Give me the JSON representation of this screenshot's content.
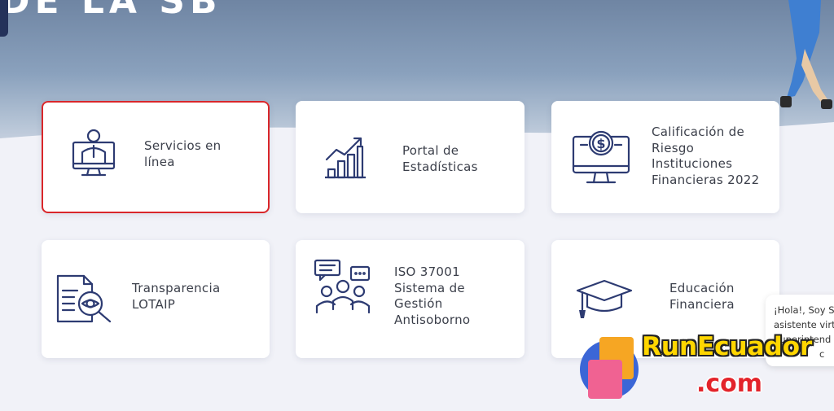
{
  "hero": {
    "title": "DE LA SB"
  },
  "cards": [
    {
      "label": "Servicios en línea",
      "icon": "online-services-icon",
      "selected": true
    },
    {
      "label": "Portal de Estadísticas",
      "icon": "statistics-chart-icon"
    },
    {
      "label": "Calificación de Riesgo Instituciones Financieras 2022",
      "icon": "dollar-monitor-icon"
    },
    {
      "label": "Transparencia LOTAIP",
      "icon": "document-search-icon"
    },
    {
      "label": "ISO 37001 Sistema de Gestión Antisoborno",
      "icon": "team-chat-icon"
    },
    {
      "label": "Educación Financiera",
      "icon": "graduation-cap-icon"
    }
  ],
  "chat": {
    "line1": "¡Hola!, Soy S",
    "line2": "asistente virt",
    "line3": "Superintend",
    "line4": "c"
  },
  "watermark": {
    "brand": "RunEcuador",
    "domain": ".com"
  },
  "colors": {
    "icon": "#2d3b72",
    "selected_border": "#d9262a"
  }
}
